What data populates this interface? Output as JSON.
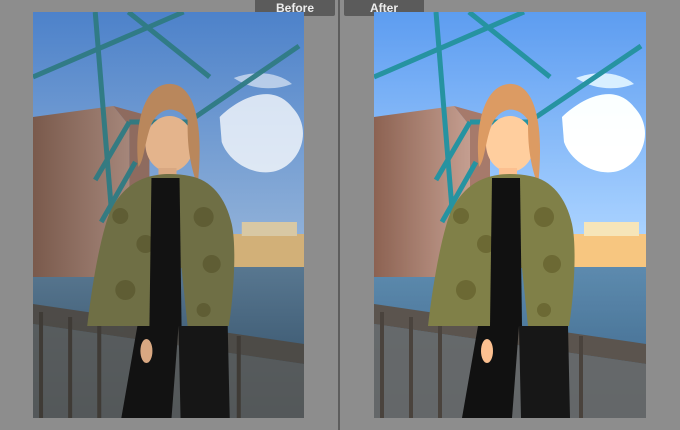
{
  "view": {
    "before_label": "Before",
    "after_label": "After"
  },
  "photo": {
    "subject": "woman-in-camo-jacket",
    "sky_color": "#5d8fd1",
    "water_color": "#3d5d79",
    "jacket_color": "#6f6f45"
  }
}
